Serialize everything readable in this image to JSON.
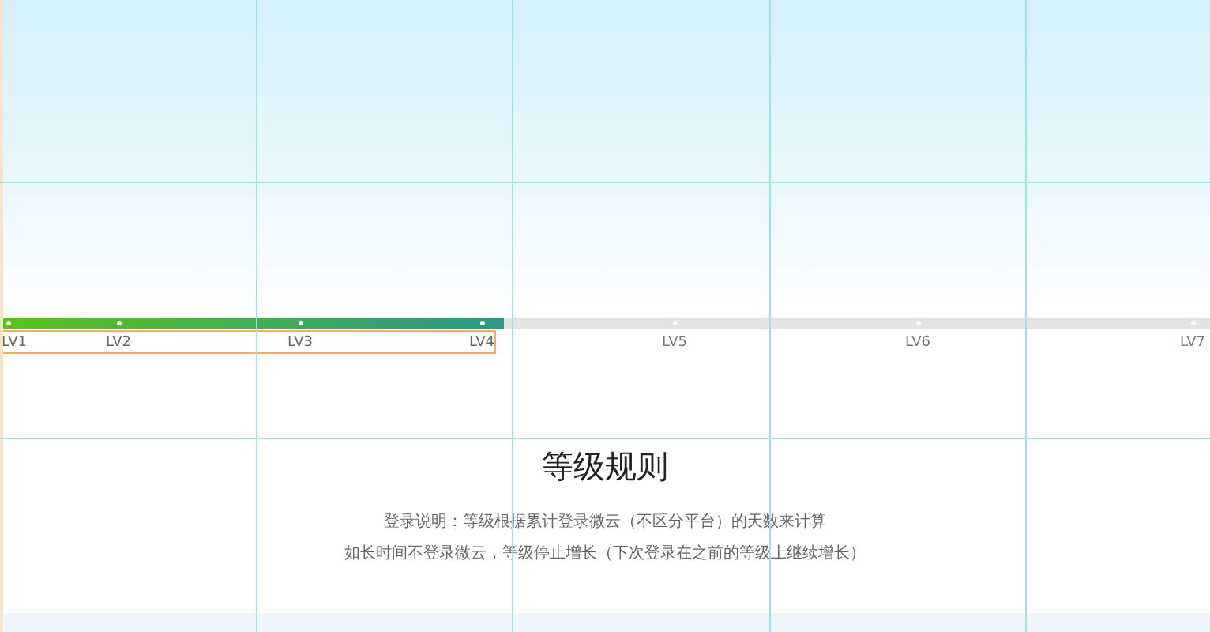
{
  "progress": {
    "level": 0.416
  },
  "levels": [
    {
      "label": "LV1",
      "reached": true
    },
    {
      "label": "LV2",
      "reached": true
    },
    {
      "label": "LV3",
      "reached": true
    },
    {
      "label": "LV4",
      "reached": true
    },
    {
      "label": "LV5",
      "reached": false
    },
    {
      "label": "LV6",
      "reached": false
    },
    {
      "label": "LV7",
      "reached": false
    }
  ],
  "rules": {
    "title": "等级规则",
    "lines": [
      "登录说明：等级根据累计登录微云（不区分平台）的天数来计算",
      "如长时间不登录微云，等级停止增长（下次登录在之前的等级上继续增长）"
    ]
  }
}
